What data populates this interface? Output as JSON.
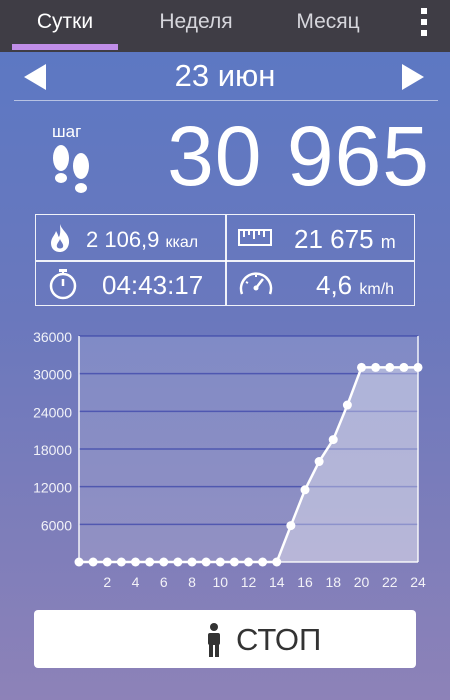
{
  "tabs": [
    {
      "label": "Сутки",
      "active": true
    },
    {
      "label": "Неделя",
      "active": false
    },
    {
      "label": "Месяц",
      "active": false
    }
  ],
  "menu_icon": "more-vert-icon",
  "date": {
    "label": "23 июн"
  },
  "steps": {
    "label": "шаг",
    "value": "30 965"
  },
  "stats": {
    "calories": {
      "value": "2 106,9",
      "unit": "ккал",
      "icon": "fire-icon"
    },
    "distance": {
      "value": "21 675",
      "unit": "m",
      "icon": "ruler-icon"
    },
    "duration": {
      "value": "04:43:17",
      "icon": "stopwatch-icon"
    },
    "speed": {
      "value": "4,6",
      "unit": "km/h",
      "icon": "speedometer-icon"
    }
  },
  "colors": {
    "tab_bar": "#3f3d45",
    "tab_indicator": "#c08ee8",
    "gradient_top": "#5a78c4",
    "gradient_bottom": "#8d82b8"
  },
  "chart_data": {
    "type": "area",
    "x": [
      0,
      1,
      2,
      3,
      4,
      5,
      6,
      7,
      8,
      9,
      10,
      11,
      12,
      13,
      14,
      15,
      16,
      17,
      18,
      19,
      20,
      21,
      22,
      23,
      24
    ],
    "values": [
      0,
      0,
      0,
      0,
      0,
      0,
      0,
      0,
      0,
      0,
      0,
      0,
      0,
      0,
      0,
      5800,
      11500,
      16000,
      19500,
      25000,
      31000,
      31000,
      31000,
      31000,
      31000
    ],
    "xticks": [
      "2",
      "4",
      "6",
      "8",
      "10",
      "12",
      "14",
      "16",
      "18",
      "20",
      "22",
      "24"
    ],
    "yticks": [
      "6000",
      "12000",
      "18000",
      "24000",
      "30000",
      "36000"
    ],
    "ylim": [
      0,
      36000
    ],
    "xlim": [
      0,
      24
    ],
    "grid": true
  },
  "stop_button": {
    "label": "СТОП",
    "icon": "person-icon"
  }
}
